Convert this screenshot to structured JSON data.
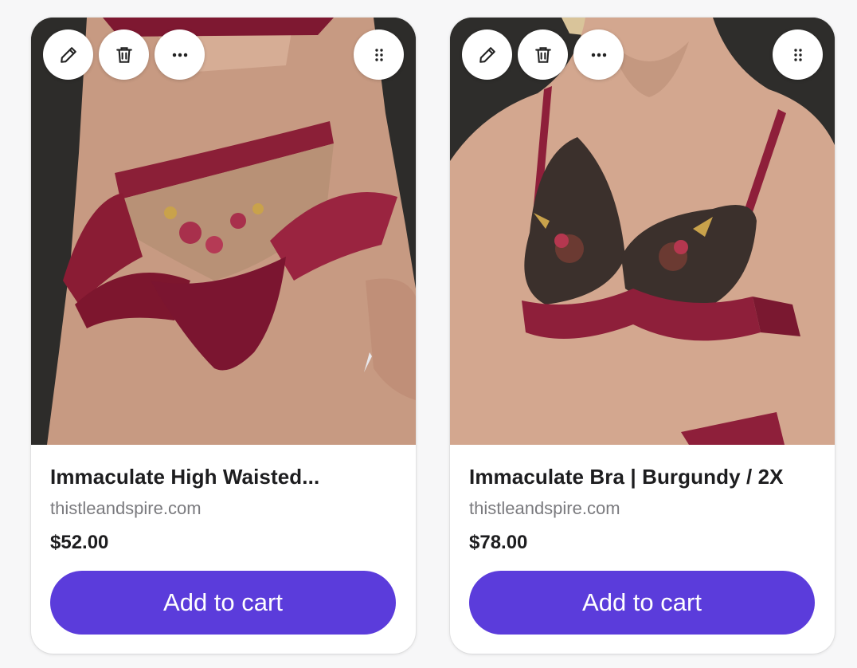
{
  "colors": {
    "accent": "#5b3cdb",
    "card_bg": "#ffffff",
    "page_bg": "#f7f7f8",
    "burgundy": "#8e1f3a"
  },
  "products": [
    {
      "title": "Immaculate High Waisted...",
      "domain": "thistleandspire.com",
      "price": "$52.00",
      "cta": "Add to cart",
      "icons": [
        "pencil-icon",
        "trash-icon",
        "more-horizontal-icon",
        "drag-handle-icon"
      ]
    },
    {
      "title": "Immaculate Bra | Burgundy / 2X",
      "domain": "thistleandspire.com",
      "price": "$78.00",
      "cta": "Add to cart",
      "icons": [
        "pencil-icon",
        "trash-icon",
        "more-horizontal-icon",
        "drag-handle-icon"
      ]
    }
  ]
}
